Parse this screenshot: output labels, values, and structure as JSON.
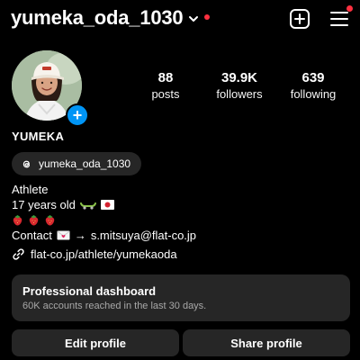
{
  "colors": {
    "background": "#000000",
    "text": "#ffffff",
    "muted": "#a8a8a8",
    "surface": "#262626",
    "pill": "#262626",
    "notification_dot": "#ff3040",
    "add_story_blue": "#0095f6"
  },
  "header": {
    "username": "yumeka_oda_1030",
    "icons": [
      "chevron-down-icon",
      "notification-dot",
      "create-post-icon",
      "menu-icon"
    ]
  },
  "profile": {
    "stats": [
      {
        "value": "88",
        "label": "posts"
      },
      {
        "value": "39.9K",
        "label": "followers"
      },
      {
        "value": "639",
        "label": "following"
      }
    ],
    "display_name": "YUMEKA",
    "threads_handle": "yumeka_oda_1030",
    "bio": {
      "category": "Athlete",
      "age_line": "17 years old",
      "contact_prefix": "Contact",
      "contact_arrow": "→",
      "contact_email": "s.mitsuya@flat-co.jp"
    },
    "link": "flat-co.jp/athlete/yumekaoda"
  },
  "dashboard": {
    "title": "Professional dashboard",
    "subtitle": "60K accounts reached in the last 30 days."
  },
  "actions": {
    "edit_label": "Edit profile",
    "share_label": "Share profile"
  }
}
